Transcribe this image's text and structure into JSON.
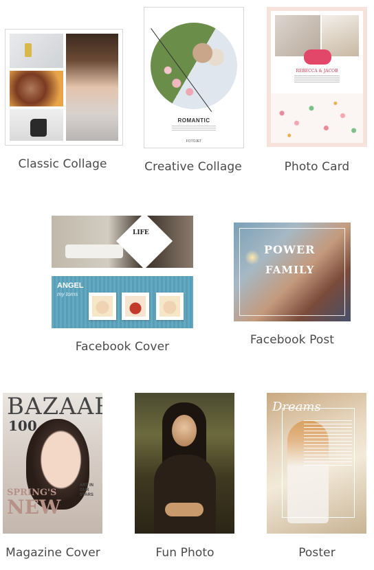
{
  "templates": [
    {
      "id": "classic-collage",
      "label": "Classic Collage"
    },
    {
      "id": "creative-collage",
      "label": "Creative Collage",
      "thumb_title": "ROMANTIC",
      "thumb_brand": "FOTOJET"
    },
    {
      "id": "photo-card",
      "label": "Photo Card",
      "thumb_names": "REBECCA & JACOB"
    },
    {
      "id": "facebook-cover",
      "label": "Facebook Cover",
      "thumb_life": "LIFE",
      "thumb_angel": "ANGEL",
      "thumb_angel_sub": "my toms"
    },
    {
      "id": "facebook-post",
      "label": "Facebook Post",
      "thumb_power": "POWER",
      "thumb_family": "FAMILY"
    },
    {
      "id": "magazine-cover",
      "label": "Magazine Cover",
      "thumb_masthead": "BAZAAR",
      "thumb_100": "100",
      "thumb_springs": "SPRING'S",
      "thumb_new": "NEW",
      "thumb_art": "ART IN OUR STARS"
    },
    {
      "id": "fun-photo",
      "label": "Fun Photo"
    },
    {
      "id": "poster",
      "label": "Poster",
      "thumb_dreams": "Dreams"
    }
  ]
}
